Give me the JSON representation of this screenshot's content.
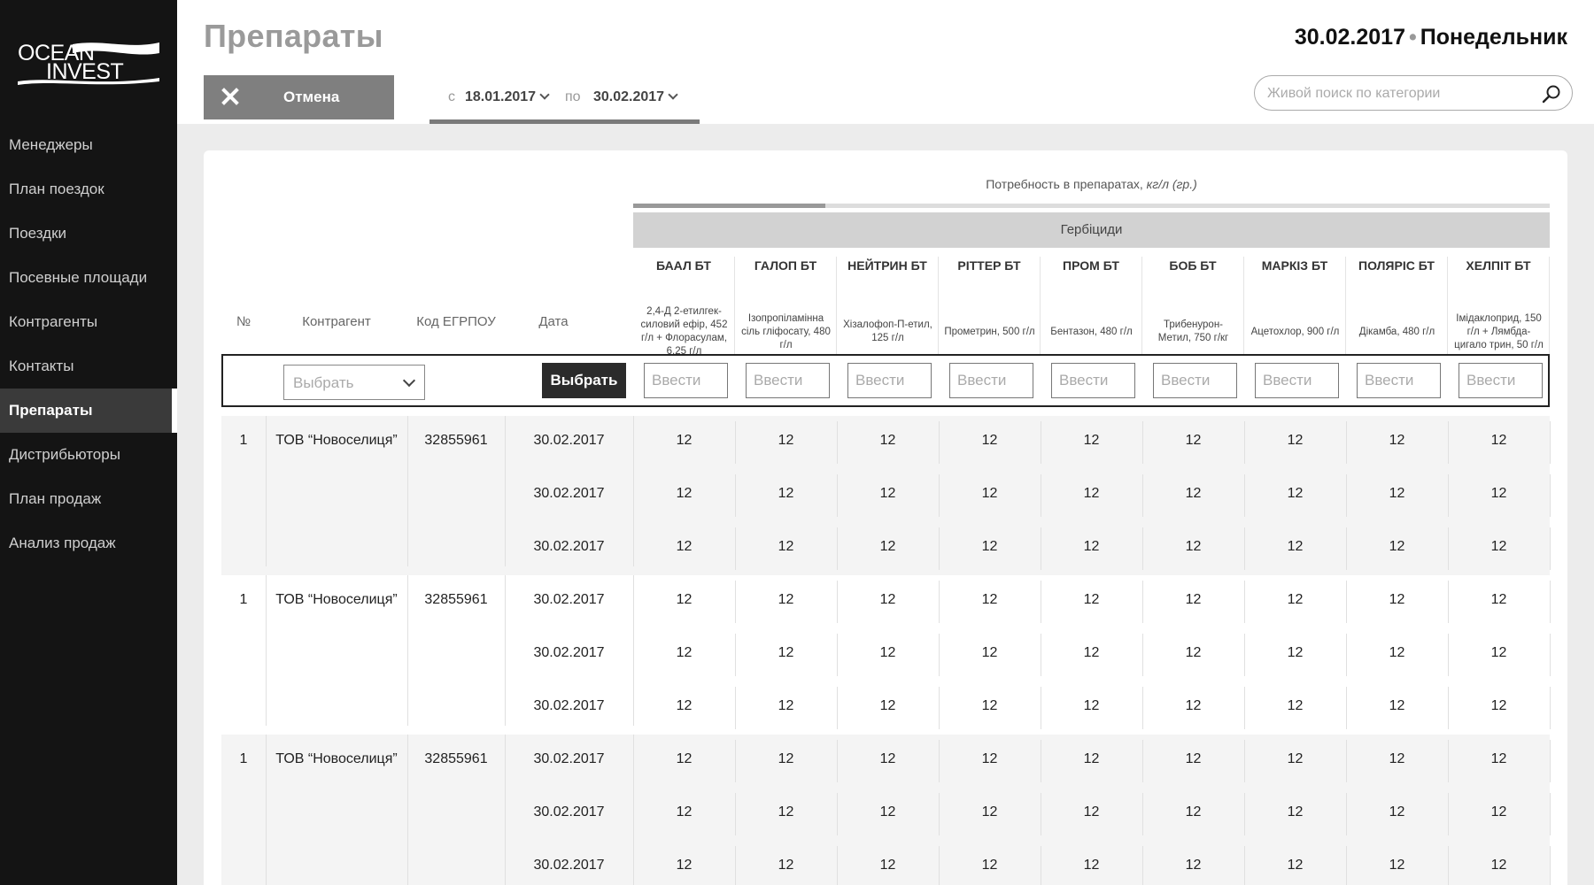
{
  "app": {
    "logo_line1": "OCEAN",
    "logo_line2": "INVEST"
  },
  "sidebar": {
    "items": [
      {
        "label": "Менеджеры",
        "active": false
      },
      {
        "label": "План поездок",
        "active": false
      },
      {
        "label": "Поездки",
        "active": false
      },
      {
        "label": "Посевные площади",
        "active": false
      },
      {
        "label": "Контрагенты",
        "active": false
      },
      {
        "label": "Контакты",
        "active": false
      },
      {
        "label": "Препараты",
        "active": true
      },
      {
        "label": "Дистрибьюторы",
        "active": false
      },
      {
        "label": "План продаж",
        "active": false
      },
      {
        "label": "Анализ продаж",
        "active": false
      }
    ]
  },
  "header": {
    "title": "Препараты",
    "cancel_label": "Отмена",
    "date_from_prefix": "с",
    "date_from": "18.01.2017",
    "date_to_prefix": "по",
    "date_to": "30.02.2017",
    "current_date": "30.02.2017",
    "current_day": "Понедельник",
    "search_placeholder": "Живой поиск по категории"
  },
  "table": {
    "need_title": "Потребность в препаратах,",
    "need_unit": "кг/л (гр.)",
    "need_progress": 0.21,
    "category": "Гербіциди",
    "columns": {
      "num": "№",
      "contractor": "Контрагент",
      "code": "Код ЕГРПОУ",
      "date": "Дата"
    },
    "drugs": [
      {
        "name": "БААЛ БТ",
        "sub": "2,4-Д 2-етилгек-силовий ефір, 452 г/л + Флорасулам, 6,25 г/л"
      },
      {
        "name": "ГАЛОП БТ",
        "sub": "Ізопропіламінна сіль гліфосату, 480 г/л"
      },
      {
        "name": "НЕЙТРИН БТ",
        "sub": "Хізалофоп-П-етил, 125 г/л"
      },
      {
        "name": "РІТТЕР БТ",
        "sub": "Прометрин, 500 г/л"
      },
      {
        "name": "ПРОМ БТ",
        "sub": "Бентазон, 480 г/л"
      },
      {
        "name": "БОБ БТ",
        "sub": "Трибенурон-Метил, 750 г/кг"
      },
      {
        "name": "МАРКІЗ БТ",
        "sub": "Ацетохлор, 900 г/л"
      },
      {
        "name": "ПОЛЯРІС БТ",
        "sub": "Дікамба, 480 г/л"
      },
      {
        "name": "ХЕЛПІТ БТ",
        "sub": "Імідаклоприд, 150 г/л + Лямбда-цигало трин, 50 г/л"
      }
    ],
    "filter": {
      "select_placeholder": "Выбрать",
      "pick_button": "Выбрать",
      "input_placeholder": "Ввести"
    },
    "groups": [
      {
        "num": "1",
        "contractor": "ТОВ “Новоселиця”",
        "code": "32855961",
        "rows": [
          {
            "date": "30.02.2017",
            "values": [
              "12",
              "12",
              "12",
              "12",
              "12",
              "12",
              "12",
              "12",
              "12"
            ]
          },
          {
            "date": "30.02.2017",
            "values": [
              "12",
              "12",
              "12",
              "12",
              "12",
              "12",
              "12",
              "12",
              "12"
            ]
          },
          {
            "date": "30.02.2017",
            "values": [
              "12",
              "12",
              "12",
              "12",
              "12",
              "12",
              "12",
              "12",
              "12"
            ]
          }
        ]
      },
      {
        "num": "1",
        "contractor": "ТОВ “Новоселиця”",
        "code": "32855961",
        "rows": [
          {
            "date": "30.02.2017",
            "values": [
              "12",
              "12",
              "12",
              "12",
              "12",
              "12",
              "12",
              "12",
              "12"
            ]
          },
          {
            "date": "30.02.2017",
            "values": [
              "12",
              "12",
              "12",
              "12",
              "12",
              "12",
              "12",
              "12",
              "12"
            ]
          },
          {
            "date": "30.02.2017",
            "values": [
              "12",
              "12",
              "12",
              "12",
              "12",
              "12",
              "12",
              "12",
              "12"
            ]
          }
        ]
      },
      {
        "num": "1",
        "contractor": "ТОВ “Новоселиця”",
        "code": "32855961",
        "rows": [
          {
            "date": "30.02.2017",
            "values": [
              "12",
              "12",
              "12",
              "12",
              "12",
              "12",
              "12",
              "12",
              "12"
            ]
          },
          {
            "date": "30.02.2017",
            "values": [
              "12",
              "12",
              "12",
              "12",
              "12",
              "12",
              "12",
              "12",
              "12"
            ]
          },
          {
            "date": "30.02.2017",
            "values": [
              "12",
              "12",
              "12",
              "12",
              "12",
              "12",
              "12",
              "12",
              "12"
            ]
          }
        ]
      }
    ]
  },
  "colors": {
    "sidebar_bg": "#141414",
    "active_item_bg": "#3a3a3a",
    "cancel_bg": "#7f7f7f",
    "pick_bg": "#2b2b2b",
    "category_bg": "#d2d2d2"
  },
  "icons": {
    "cancel": "close-icon",
    "search": "search-icon",
    "dropdown": "chevron-down-icon"
  }
}
